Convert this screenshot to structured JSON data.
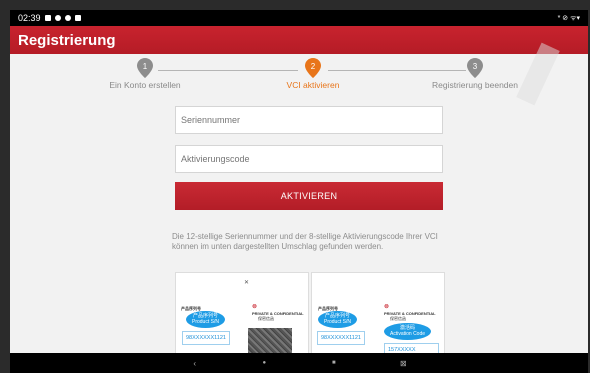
{
  "status": {
    "time": "02:39",
    "right_icons": "* ⊘ ᯤ▾"
  },
  "app": {
    "title": "Registrierung"
  },
  "steps": [
    {
      "number": "1",
      "label": "Ein Konto erstellen",
      "active": false
    },
    {
      "number": "2",
      "label": "VCI aktivieren",
      "active": true
    },
    {
      "number": "3",
      "label": "Registrierung beenden",
      "active": false
    }
  ],
  "form": {
    "serial_placeholder": "Seriennummer",
    "code_placeholder": "Aktivierungscode",
    "activate_label": "AKTIVIEREN"
  },
  "hint": "Die 12-stellige Seriennummer und der 8-stellige Aktivierungscode Ihrer VCI können im unten dargestellten Umschlag gefunden werden.",
  "envelope": {
    "left": {
      "title_cn": "产品序列号",
      "brand": "PRIVATE & CONFIDENTIAL",
      "brand_cn": "保密信函",
      "bubble": "产品序列号\nProduct S/N",
      "serial": "98XXXXXX1121"
    },
    "right": {
      "title_cn": "产品序列号",
      "brand": "PRIVATE & CONFIDENTIAL",
      "brand_cn": "保密信函",
      "bubble_sn": "产品序列号\nProduct S/N",
      "bubble_code": "激活码\nActivation Code",
      "serial": "98XXXXXX1121",
      "code": "157XXXXX"
    }
  },
  "colors": {
    "accent": "#c8232e",
    "step_active": "#e8751a",
    "step_inactive": "#8a8a8a",
    "bubble": "#1e9ce5"
  },
  "nav": {
    "back": "‹",
    "home": "●",
    "recents": "■",
    "screenshot": "⊠"
  }
}
